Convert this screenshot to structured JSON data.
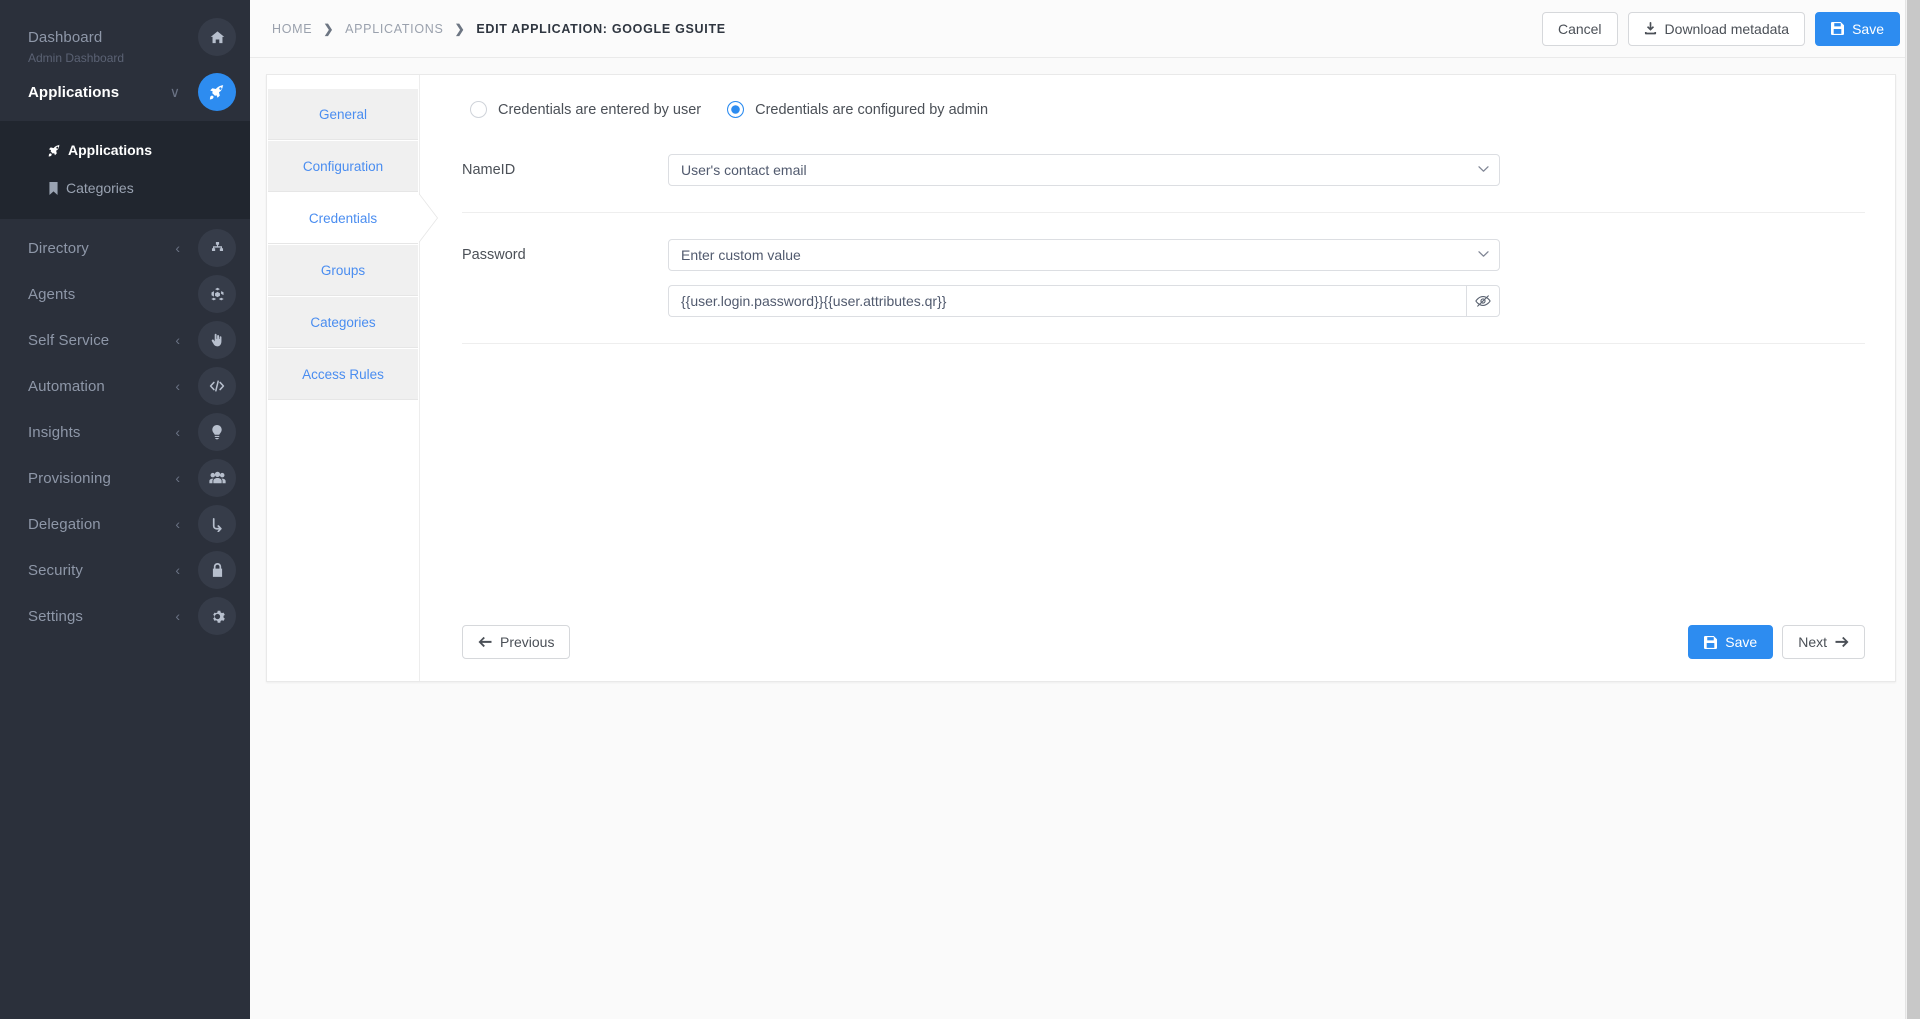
{
  "sidebar": {
    "dashboard": {
      "title": "Dashboard",
      "subtitle": "Admin Dashboard",
      "icon": "home-icon"
    },
    "applications": {
      "title": "Applications",
      "icon": "rocket-icon",
      "caret": "∨"
    },
    "submenu": [
      {
        "label": "Applications",
        "icon": "rocket-icon"
      },
      {
        "label": "Categories",
        "icon": "bookmark-icon"
      }
    ],
    "items": [
      {
        "label": "Directory",
        "icon": "sitemap-icon",
        "caret": "‹"
      },
      {
        "label": "Agents",
        "icon": "cubes-icon",
        "caret": ""
      },
      {
        "label": "Self Service",
        "icon": "hand-icon",
        "caret": "‹"
      },
      {
        "label": "Automation",
        "icon": "code-icon",
        "caret": "‹"
      },
      {
        "label": "Insights",
        "icon": "lightbulb-icon",
        "caret": "‹"
      },
      {
        "label": "Provisioning",
        "icon": "users-icon",
        "caret": "‹"
      },
      {
        "label": "Delegation",
        "icon": "arrow-down-icon",
        "caret": "‹"
      },
      {
        "label": "Security",
        "icon": "lock-icon",
        "caret": "‹"
      },
      {
        "label": "Settings",
        "icon": "gear-icon",
        "caret": "‹"
      }
    ]
  },
  "breadcrumb": {
    "home": "HOME",
    "applications": "APPLICATIONS",
    "current": "EDIT APPLICATION: GOOGLE GSUITE",
    "separator": "❯"
  },
  "topbar": {
    "cancel": "Cancel",
    "download_metadata": "Download metadata",
    "save": "Save"
  },
  "tabs": [
    {
      "label": "General",
      "active": false
    },
    {
      "label": "Configuration",
      "active": false
    },
    {
      "label": "Credentials",
      "active": true
    },
    {
      "label": "Groups",
      "active": false
    },
    {
      "label": "Categories",
      "active": false
    },
    {
      "label": "Access Rules",
      "active": false
    }
  ],
  "form": {
    "radio_user": {
      "label": "Credentials are entered by user",
      "selected": false
    },
    "radio_admin": {
      "label": "Credentials are configured by admin",
      "selected": true
    },
    "nameid": {
      "label": "NameID",
      "value": "User's contact email",
      "options": [
        "User's contact email"
      ]
    },
    "password": {
      "label": "Password",
      "mode_value": "Enter custom value",
      "mode_options": [
        "Enter custom value"
      ],
      "custom_value": "{{user.login.password}}{{user.attributes.qr}}",
      "custom_placeholder": "",
      "toggle_icon": "eye-slash-icon"
    }
  },
  "footer": {
    "previous": "Previous",
    "save": "Save",
    "next": "Next"
  },
  "colors": {
    "accent": "#2d8cf0",
    "sidebar_bg": "#2b303b",
    "submenu_bg": "#21262f",
    "tab_link": "#4a8df0"
  }
}
